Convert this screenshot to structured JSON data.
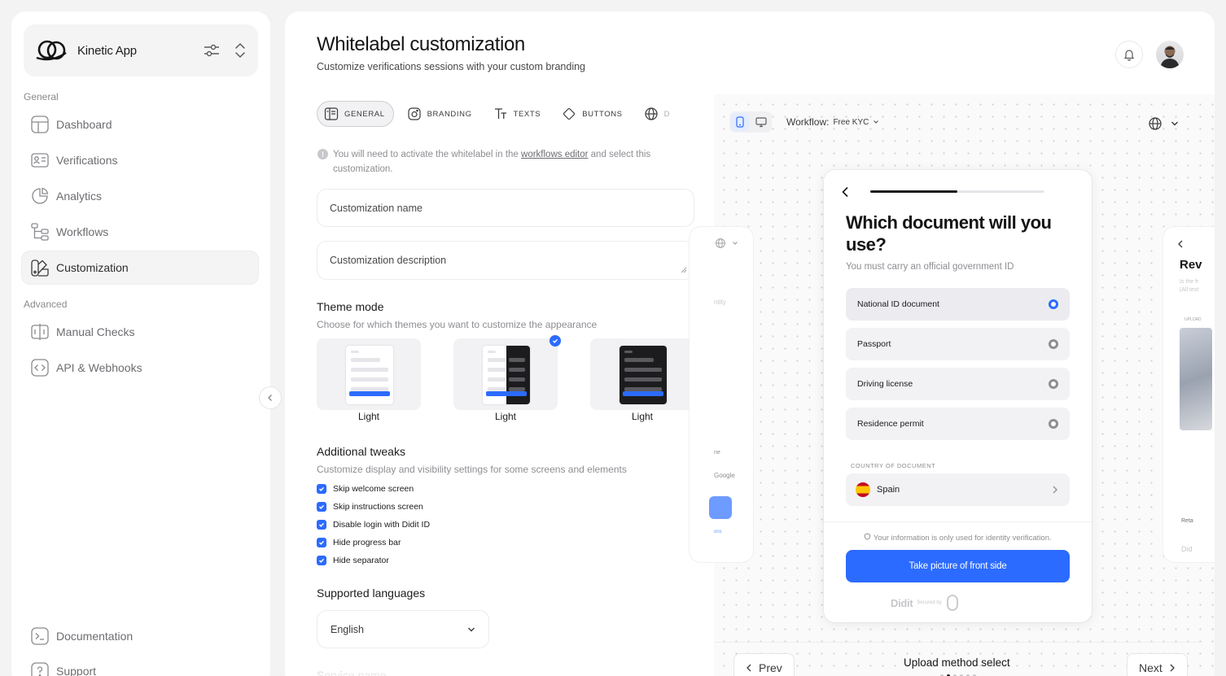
{
  "sidebar": {
    "app_name": "Kinetic App",
    "section_general": "General",
    "section_advanced": "Advanced",
    "items": [
      {
        "label": "Dashboard"
      },
      {
        "label": "Verifications"
      },
      {
        "label": "Analytics"
      },
      {
        "label": "Workflows"
      },
      {
        "label": "Customization"
      },
      {
        "label": "Manual Checks"
      },
      {
        "label": "API & Webhooks"
      },
      {
        "label": "Documentation"
      },
      {
        "label": "Support"
      }
    ]
  },
  "header": {
    "title": "Whitelabel customization",
    "subtitle": "Customize verifications sessions with your custom branding"
  },
  "tabs": [
    {
      "label": "GENERAL"
    },
    {
      "label": "BRANDING"
    },
    {
      "label": "TEXTS"
    },
    {
      "label": "BUTTONS"
    },
    {
      "label": "D"
    }
  ],
  "info_note": {
    "before": "You will need to activate the whitelabel in the ",
    "link": "workflows editor",
    "after": " and select this customization."
  },
  "form": {
    "name_placeholder": "Customization name",
    "description_placeholder": "Customization description"
  },
  "theme_mode": {
    "title": "Theme mode",
    "description": "Choose for which themes you want to customize the appearance",
    "options": [
      {
        "label": "Light"
      },
      {
        "label": "Light"
      },
      {
        "label": "Light"
      }
    ]
  },
  "tweaks": {
    "title": "Additional tweaks",
    "description": "Customize display and visibility settings for some screens and elements",
    "items": [
      {
        "label": "Skip welcome screen",
        "checked": true
      },
      {
        "label": "Skip instructions screen",
        "checked": true
      },
      {
        "label": "Disable login with Didit ID",
        "checked": true
      },
      {
        "label": "Hide progress bar",
        "checked": true
      },
      {
        "label": "Hide separator",
        "checked": true
      }
    ]
  },
  "languages": {
    "title": "Supported languages",
    "selected": "English"
  },
  "service_name": {
    "title": "Service name"
  },
  "preview": {
    "workflow_label": "Workflow:",
    "workflow_value": "Free KYC",
    "phone": {
      "title": "Which document will you use?",
      "subtitle": "You must carry an official government ID",
      "progress": 0.5,
      "options": [
        {
          "label": "National ID document",
          "selected": true
        },
        {
          "label": "Passport",
          "selected": false
        },
        {
          "label": "Driving license",
          "selected": false
        },
        {
          "label": "Residence permit",
          "selected": false
        }
      ],
      "country_label": "COUNTRY OF DOCUMENT",
      "country": "Spain",
      "privacy": "Your information is only used for identity verification.",
      "cta": "Take picture of front side",
      "brand": "Didit",
      "secured": "Secured by"
    },
    "side_fragments": {
      "left": [
        "ntity",
        "ne",
        "Google",
        "ons"
      ],
      "right": [
        "Rev",
        "Is the fr",
        "(All text",
        "UPLOAD",
        "Reta",
        "Did"
      ]
    },
    "prev_label": "Prev",
    "next_label": "Next",
    "screen_name": "Upload method select",
    "pager": {
      "total": 6,
      "current": 1
    }
  },
  "colors": {
    "accent": "#2c6bff",
    "background": "#f3f3f4"
  }
}
